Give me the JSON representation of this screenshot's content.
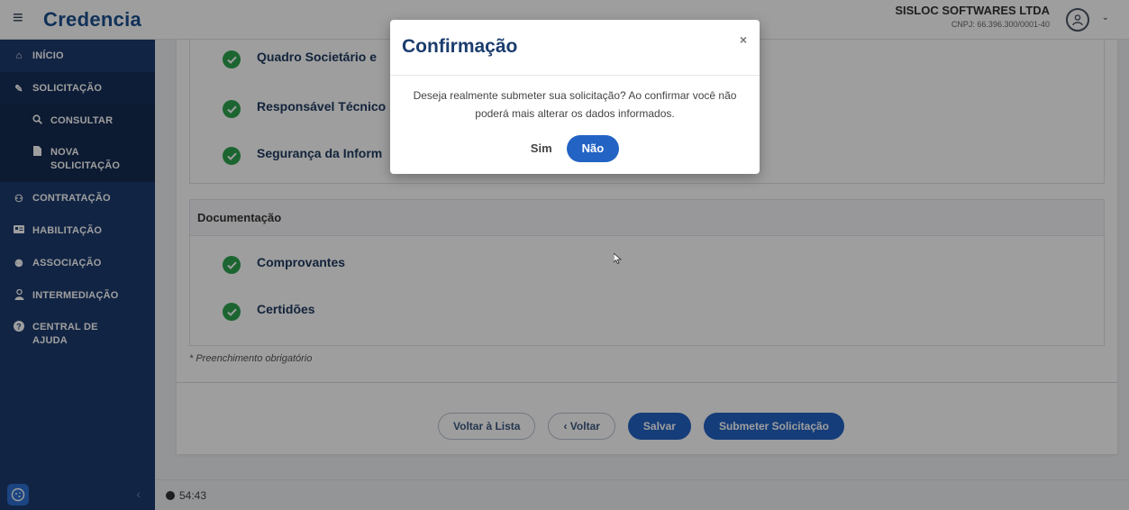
{
  "header": {
    "brand": "Credencia",
    "company_name": "SISLOC SOFTWARES LTDA",
    "company_cnpj": "CNPJ: 66.396.300/0001-40"
  },
  "sidebar": {
    "items": [
      {
        "label": "INÍCIO",
        "icon": "home-icon"
      },
      {
        "label": "SOLICITAÇÃO",
        "icon": "edit-icon"
      },
      {
        "label": "CONSULTAR",
        "icon": "search-icon"
      },
      {
        "label": "NOVA SOLICITAÇÃO",
        "icon": "file-icon"
      },
      {
        "label": "CONTRATAÇÃO",
        "icon": "handshake-icon"
      },
      {
        "label": "HABILITAÇÃO",
        "icon": "id-card-icon"
      },
      {
        "label": "ASSOCIAÇÃO",
        "icon": "users-icon"
      },
      {
        "label": "INTERMEDIAÇÃO",
        "icon": "user-tie-icon"
      },
      {
        "label": "CENTRAL DE AJUDA",
        "icon": "help-icon"
      }
    ]
  },
  "main": {
    "section1_items": [
      "Quadro Societário e",
      "Responsável Técnico",
      "Segurança da Inform"
    ],
    "section2_title": "Documentação",
    "section2_items": [
      "Comprovantes",
      "Certidões"
    ],
    "required_note": "* Preenchimento obrigatório",
    "buttons": {
      "back_list": "Voltar à Lista",
      "back": "‹ Voltar",
      "save": "Salvar",
      "submit": "Submeter Solicitação"
    }
  },
  "footer": {
    "timer": "54:43"
  },
  "modal": {
    "title": "Confirmação",
    "close": "×",
    "message": "Deseja realmente submeter sua solicitação? Ao confirmar você não poderá mais alterar os dados informados.",
    "yes_label": "Sim",
    "no_label": "Não"
  },
  "colors": {
    "brand": "#1b4f8f",
    "sidebar": "#1c3b6e",
    "primary": "#2363c4",
    "success": "#2ea44f"
  }
}
